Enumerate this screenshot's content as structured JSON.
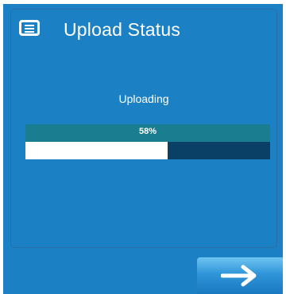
{
  "header": {
    "icon": "message-list-icon",
    "title": "Upload Status"
  },
  "upload": {
    "status": "Uploading",
    "progress_text": "58%",
    "progress_fraction": 0.58
  },
  "footer": {
    "next_icon": "arrow-right-icon"
  },
  "colors": {
    "background": "#1c80c4",
    "progress_header": "#1a7d90",
    "progress_track": "#0a3f66",
    "progress_fill": "#ffffff"
  }
}
